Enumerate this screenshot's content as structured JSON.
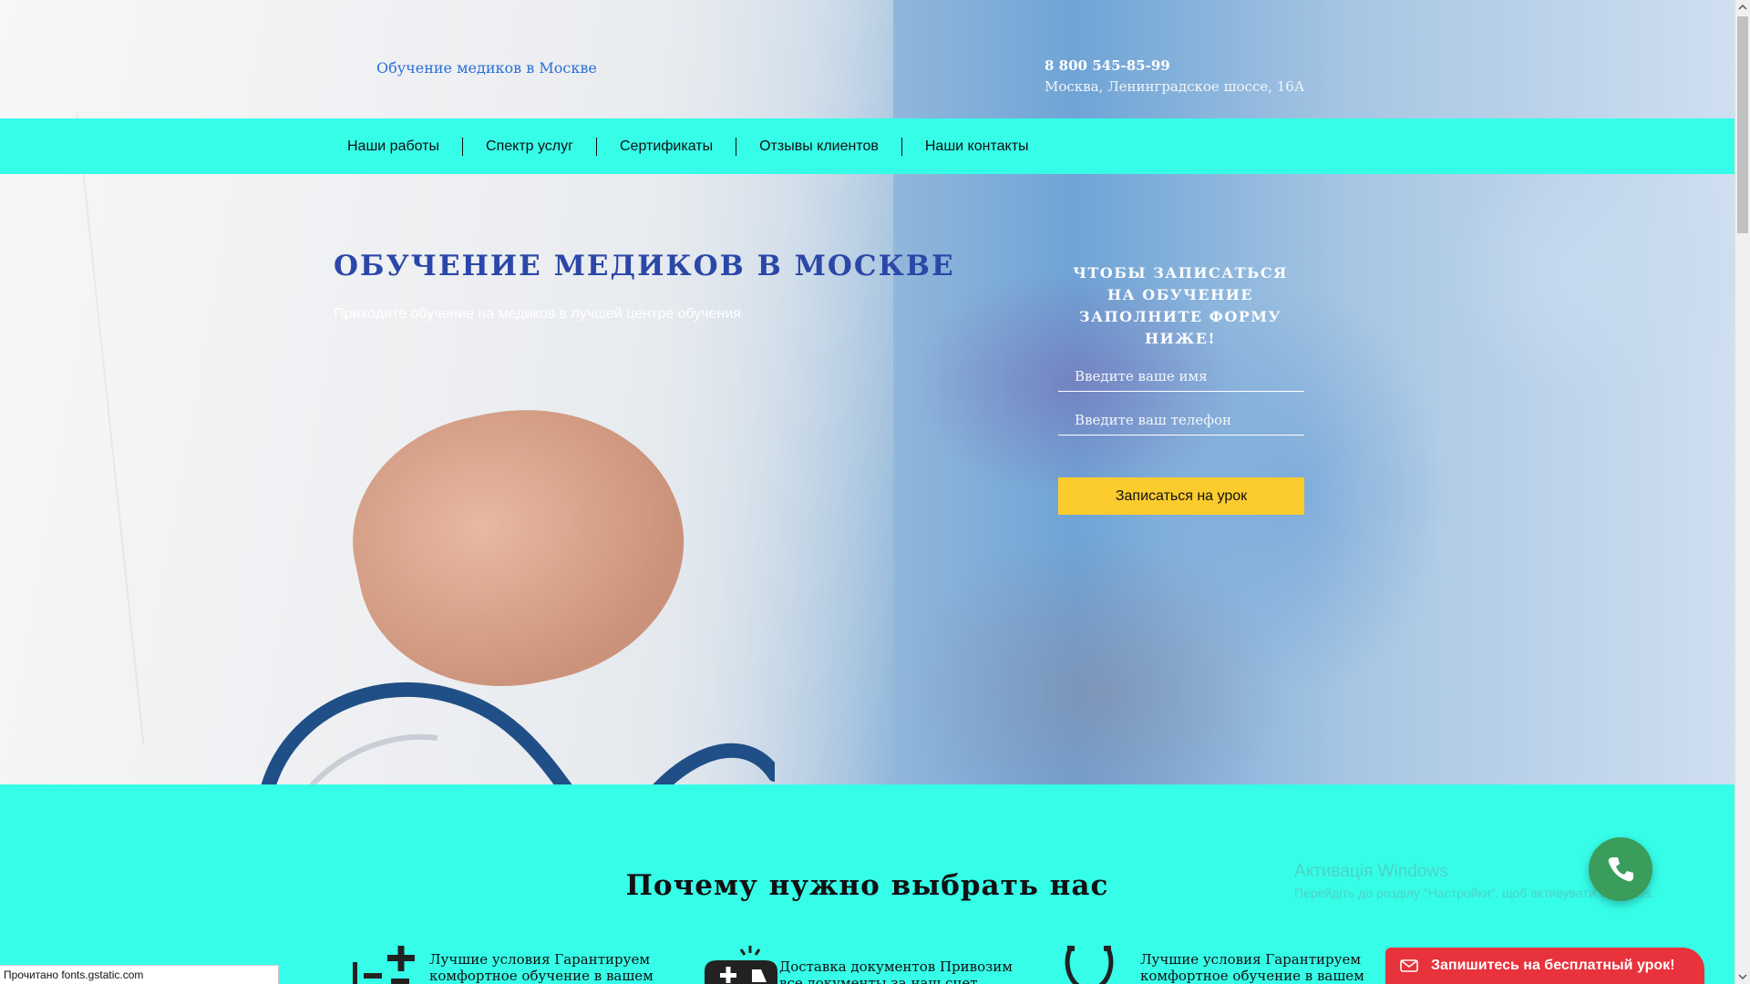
{
  "header": {
    "site_name": "Обучение медиков в Москве",
    "phone": "8 800 545-85-99",
    "address": "Москва, Ленинградское шоссе, 16А"
  },
  "nav": {
    "items": [
      {
        "label": "Наши работы"
      },
      {
        "label": "Спектр услуг"
      },
      {
        "label": "Сертификаты"
      },
      {
        "label": "Отзывы клиентов"
      },
      {
        "label": "Наши контакты"
      }
    ]
  },
  "hero": {
    "title": "ОБУЧЕНИЕ МЕДИКОВ В МОСКВЕ",
    "subtitle": "Приходите обучение на медиков в лучшей центре обучения"
  },
  "form": {
    "title": "Чтобы записаться на обучение заполните форму ниже!",
    "name_placeholder": "Введите ваше имя",
    "phone_placeholder": "Введите ваш телефон",
    "submit_label": "Записаться на урок"
  },
  "why": {
    "title": "Почему нужно выбрать нас",
    "features": [
      {
        "icon": "math-icon",
        "text": "Лучшие условия Гарантируем комфортное обучение в вашем"
      },
      {
        "icon": "doctor-bag-icon",
        "text": "Доставка документов Привозим все документы за наш счет"
      },
      {
        "icon": "stethoscope-icon",
        "text": "Лучшие условия Гарантируем комфортное обучение в вашем"
      }
    ]
  },
  "watermark": {
    "title": "Активація Windows",
    "subtitle": "Перейдіть до розділу \"Настройки\", щоб активувати Windows."
  },
  "promo": {
    "label": "Запишитесь на бесплатный урок!"
  },
  "status_bar": {
    "text": "Прочитано fonts.gstatic.com"
  },
  "colors": {
    "accent_cyan": "#36fde8",
    "title_blue": "#2b47a8",
    "button_yellow": "#fccb2e",
    "call_green": "#3a9d5b",
    "promo_red": "#e8323c"
  }
}
